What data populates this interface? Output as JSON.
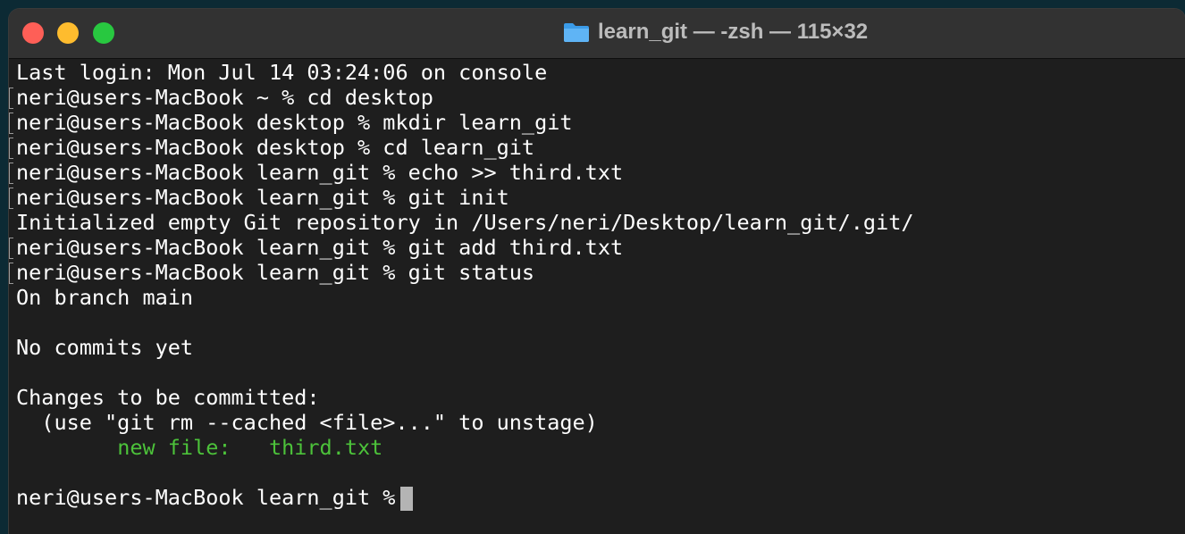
{
  "window": {
    "title": "learn_git — -zsh — 115×32",
    "folder_icon": "folder-icon",
    "colors": {
      "background": "#1e1e1e",
      "titlebar": "#323232",
      "text": "#ffffff",
      "green": "#4cc23a",
      "close": "#fe5f57",
      "minimize": "#febc2e",
      "zoom": "#28c840"
    }
  },
  "terminal": {
    "lines": [
      {
        "text": "Last login: Mon Jul 14 03:24:06 on console",
        "marked": false
      },
      {
        "text": "neri@users-MacBook ~ % cd desktop",
        "marked": true
      },
      {
        "text": "neri@users-MacBook desktop % mkdir learn_git",
        "marked": true
      },
      {
        "text": "neri@users-MacBook desktop % cd learn_git",
        "marked": true
      },
      {
        "text": "neri@users-MacBook learn_git % echo >> third.txt",
        "marked": true
      },
      {
        "text": "neri@users-MacBook learn_git % git init",
        "marked": true
      },
      {
        "text": "Initialized empty Git repository in /Users/neri/Desktop/learn_git/.git/",
        "marked": false
      },
      {
        "text": "neri@users-MacBook learn_git % git add third.txt",
        "marked": true
      },
      {
        "text": "neri@users-MacBook learn_git % git status",
        "marked": true
      },
      {
        "text": "On branch main",
        "marked": false
      },
      {
        "text": "",
        "marked": false
      },
      {
        "text": "No commits yet",
        "marked": false
      },
      {
        "text": "",
        "marked": false
      },
      {
        "text": "Changes to be committed:",
        "marked": false
      },
      {
        "text": "  (use \"git rm --cached <file>...\" to unstage)",
        "marked": false
      }
    ],
    "staged_file": {
      "indent": "        ",
      "text": "new file:   third.txt"
    },
    "prompt": "neri@users-MacBook learn_git % "
  }
}
